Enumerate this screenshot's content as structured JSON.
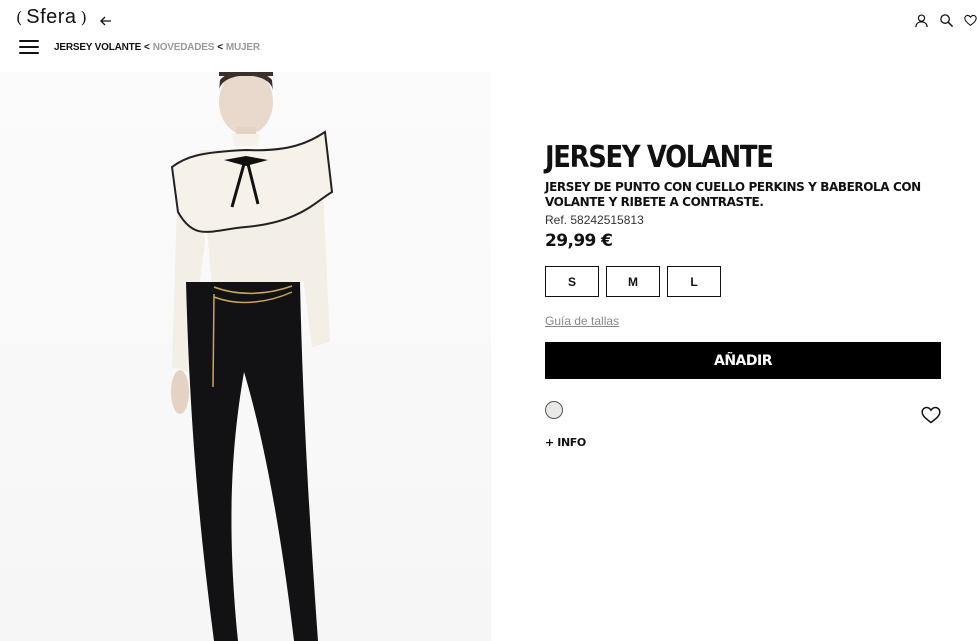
{
  "header": {
    "logo_text": "Sfera",
    "logo_open": "(",
    "logo_close": ")",
    "icons": [
      "back-arrow-icon",
      "user-icon",
      "search-icon",
      "heart-icon"
    ]
  },
  "breadcrumb": {
    "current": "JERSEY VOLANTE",
    "separator": "<",
    "items": [
      "NOVEDADES",
      "MUJER"
    ]
  },
  "product": {
    "title": "JERSEY VOLANTE",
    "description": "JERSEY DE PUNTO CON CUELLO PERKINS Y BABEROLA CON VOLANTE Y RIBETE A CONTRASTE.",
    "ref": "Ref. 58242515813",
    "price": "29,99 €",
    "sizes": [
      "S",
      "M",
      "L"
    ],
    "size_guide": "Guía de tallas",
    "add_button": "AÑADIR",
    "color_swatch": "#e9e9e7",
    "more_info": "+ INFO"
  }
}
